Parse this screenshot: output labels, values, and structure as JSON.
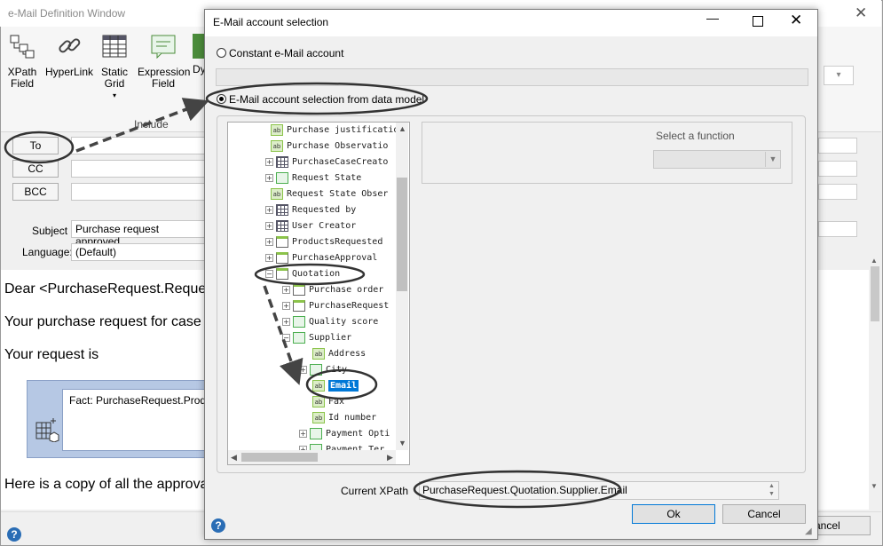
{
  "background_window": {
    "title": "e-Mail Definition Window",
    "close_glyph": "✕",
    "ribbon": {
      "buttons": [
        {
          "label_line1": "XPath",
          "label_line2": "Field",
          "icon": "xpath-field-icon"
        },
        {
          "label_line1": "HyperLink",
          "label_line2": "",
          "icon": "hyperlink-icon"
        },
        {
          "label_line1": "Static",
          "label_line2": "Grid",
          "icon": "static-grid-icon"
        },
        {
          "label_line1": "Expression",
          "label_line2": "Field",
          "icon": "expression-field-icon"
        },
        {
          "label_line1": "Dy",
          "label_line2": "",
          "icon": "dynamic-icon"
        }
      ],
      "group_label": "Include",
      "dropdown_arrow": "▾"
    },
    "recipients": {
      "to_label": "To",
      "cc_label": "CC",
      "bcc_label": "BCC"
    },
    "subject_label": "Subject",
    "subject_value": "Purchase request approved",
    "language_label": "Language:",
    "language_value": "(Default)",
    "body": {
      "line1": "Dear <PurchaseRequest.Reque",
      "line2": "Your purchase request for case",
      "line3": "Your request is",
      "fact_text": "Fact: PurchaseRequest.Produc",
      "line4": "Here is a copy of all the approva"
    },
    "cancel_label": "ancel"
  },
  "dialog": {
    "title": "E-Mail account selection",
    "min_glyph": "—",
    "close_glyph": "✕",
    "constant_option": "Constant e-Mail account",
    "datamodel_option": "E-Mail account selection from data model",
    "function_label": "Select a function",
    "current_xpath_label": "Current XPath",
    "current_xpath_value": "PurchaseRequest.Quotation.Supplier.Email",
    "ok_label": "Ok",
    "cancel_label": "Cancel",
    "help_glyph": "?",
    "tree": [
      {
        "label": "Purchase justificatio",
        "icon": "ab",
        "expand": ""
      },
      {
        "label": "Purchase Observatio",
        "icon": "ab",
        "expand": ""
      },
      {
        "label": "PurchaseCaseCreato",
        "icon": "grid",
        "expand": "+"
      },
      {
        "label": "Request State",
        "icon": "ent",
        "expand": "+"
      },
      {
        "label": "Request State Obser",
        "icon": "ab",
        "expand": ""
      },
      {
        "label": "Requested by",
        "icon": "grid",
        "expand": "+"
      },
      {
        "label": "User Creator",
        "icon": "grid",
        "expand": "+"
      },
      {
        "label": "ProductsRequested",
        "icon": "coll",
        "expand": "+"
      },
      {
        "label": "PurchaseApproval",
        "icon": "coll",
        "expand": "+"
      },
      {
        "label": "Quotation",
        "icon": "coll",
        "expand": "−"
      },
      {
        "label": "Purchase order",
        "icon": "coll",
        "expand": "+"
      },
      {
        "label": "PurchaseRequest",
        "icon": "coll",
        "expand": "+"
      },
      {
        "label": "Quality score",
        "icon": "ent",
        "expand": "+"
      },
      {
        "label": "Supplier",
        "icon": "ent",
        "expand": "−"
      },
      {
        "label": "Address",
        "icon": "ab",
        "expand": ""
      },
      {
        "label": "City",
        "icon": "ent",
        "expand": "+"
      },
      {
        "label": "Email",
        "icon": "ab",
        "expand": ""
      },
      {
        "label": "Fax",
        "icon": "ab",
        "expand": ""
      },
      {
        "label": "Id number",
        "icon": "ab",
        "expand": ""
      },
      {
        "label": "Payment Opti",
        "icon": "ent",
        "expand": "+"
      },
      {
        "label": "Payment Ter",
        "icon": "ent",
        "expand": "+"
      }
    ]
  },
  "colors": {
    "selection": "#0078d7",
    "fact_box": "#b6c8e4",
    "help_icon": "#2a6db5"
  }
}
